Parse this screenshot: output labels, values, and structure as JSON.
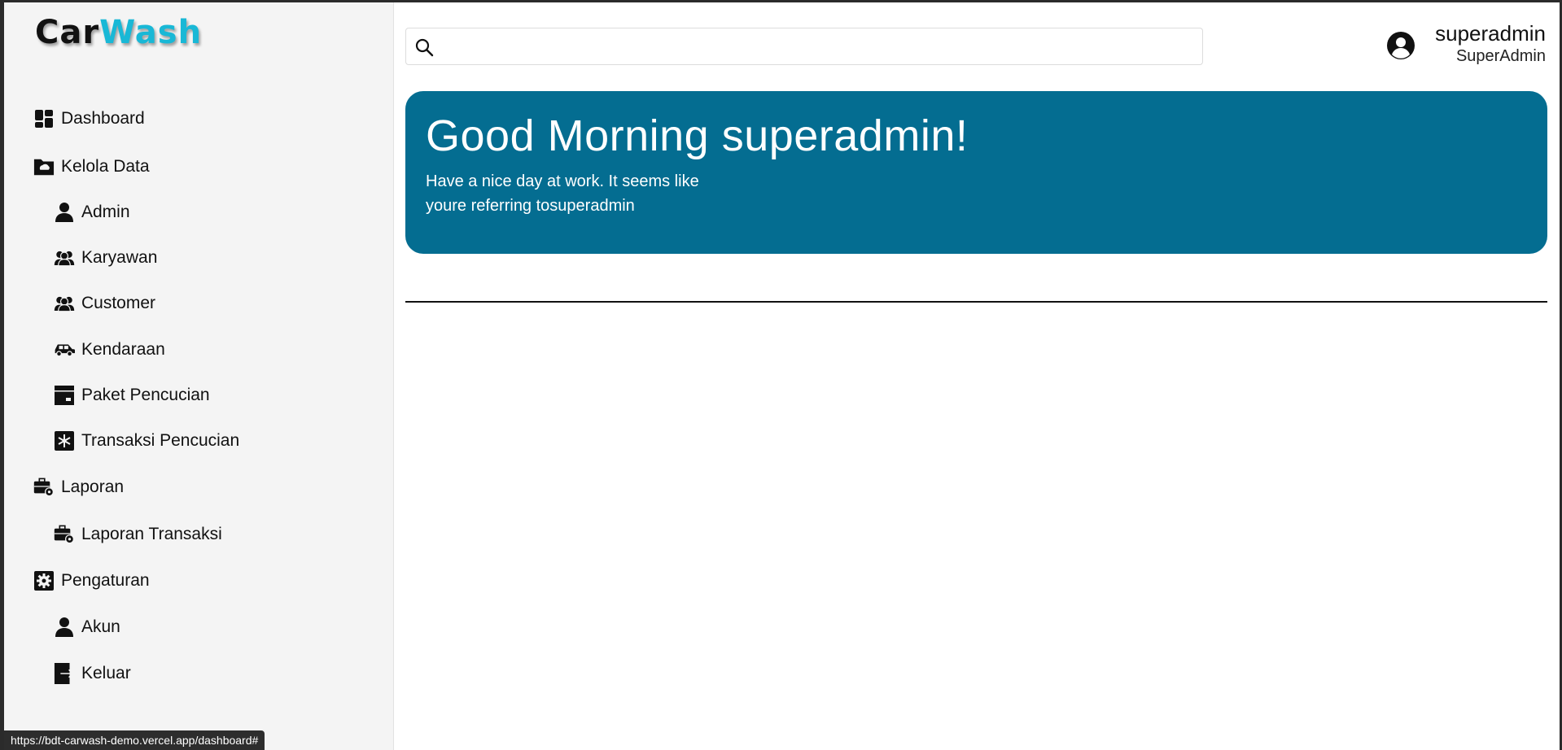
{
  "brand": {
    "part1": "Car",
    "part2": "Wash",
    "color_accent": "#19b8d6"
  },
  "sidebar": {
    "items": [
      {
        "label": "Dashboard",
        "icon": "dashboard-icon"
      },
      {
        "label": "Kelola Data",
        "icon": "folder-icon"
      },
      {
        "label": "Admin",
        "icon": "user-icon"
      },
      {
        "label": "Karyawan",
        "icon": "users-icon"
      },
      {
        "label": "Customer",
        "icon": "users-icon"
      },
      {
        "label": "Kendaraan",
        "icon": "car-icon"
      },
      {
        "label": "Paket Pencucian",
        "icon": "box-icon"
      },
      {
        "label": "Transaksi Pencucian",
        "icon": "asterisk-icon"
      },
      {
        "label": "Laporan",
        "icon": "briefcase-gear-icon"
      },
      {
        "label": "Laporan Transaksi",
        "icon": "briefcase-gear-icon"
      },
      {
        "label": "Pengaturan",
        "icon": "gear-icon"
      },
      {
        "label": "Akun",
        "icon": "user-icon"
      },
      {
        "label": "Keluar",
        "icon": "logout-icon"
      }
    ]
  },
  "header": {
    "search": {
      "value": "",
      "placeholder": ""
    },
    "user": {
      "name": "superadmin",
      "role": "SuperAdmin"
    }
  },
  "banner": {
    "greeting": "Good Morning superadmin!",
    "line1": "Have a nice day at work. It seems like",
    "line2": "youre referring tosuperadmin",
    "color": "#046d91"
  },
  "status_bar": {
    "url": "https://bdt-carwash-demo.vercel.app/dashboard#"
  }
}
